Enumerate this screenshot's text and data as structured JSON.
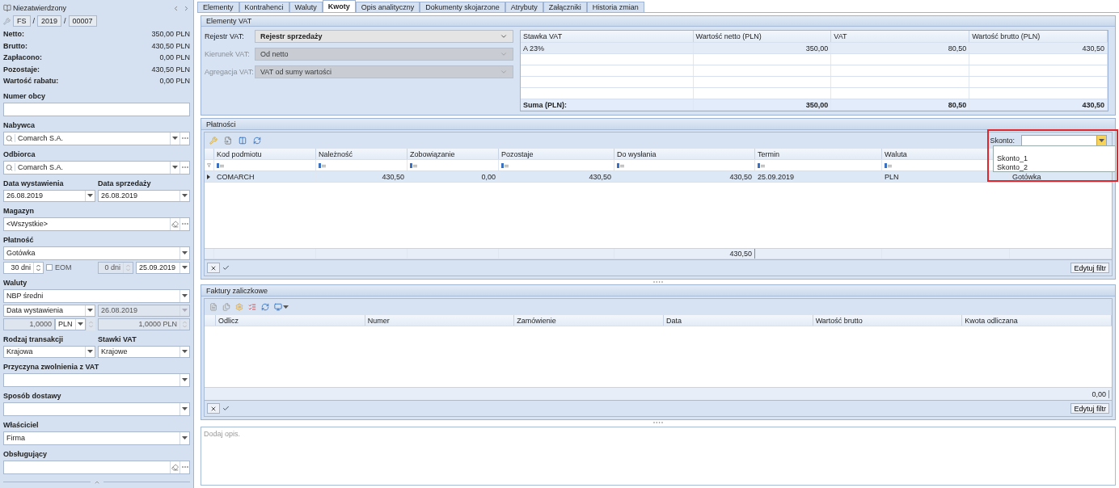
{
  "sidebar": {
    "status": "Niezatwierdzony",
    "document_number": [
      {
        "kind": "part",
        "text": "FS"
      },
      {
        "kind": "separator",
        "text": "/"
      },
      {
        "kind": "part",
        "text": "2019"
      },
      {
        "kind": "separator",
        "text": "/"
      },
      {
        "kind": "part",
        "text": "00007"
      }
    ],
    "summary": [
      {
        "label": "Netto:",
        "value": "350,00 PLN"
      },
      {
        "label": "Brutto:",
        "value": "430,50 PLN"
      },
      {
        "label": "Zapłacono:",
        "value": "0,00 PLN"
      },
      {
        "label": "Pozostaje:",
        "value": "430,50 PLN"
      },
      {
        "label": "Wartość rabatu:",
        "value": "0,00 PLN"
      }
    ],
    "fields": [
      {
        "kind": "text",
        "label": "Numer obcy"
      },
      {
        "kind": "lookup",
        "label": "Nabywca",
        "value": "Comarch S.A."
      },
      {
        "kind": "lookup",
        "label": "Odbiorca",
        "value": "Comarch S.A."
      },
      {
        "kind": "pair",
        "items": [
          {
            "label": "Data wystawienia",
            "value": "26.08.2019"
          },
          {
            "label": "Data sprzedaży",
            "value": "26.08.2019"
          }
        ]
      },
      {
        "kind": "clearable",
        "label": "Magazyn",
        "value": "<Wszystkie>"
      },
      {
        "kind": "select",
        "label": "Płatność",
        "value": "Gotówka"
      },
      {
        "kind": "terms",
        "days": "30 dni",
        "eom_label": "EOM",
        "eom_checked": false,
        "extra_days": {
          "value": "0 dni",
          "disabled": true
        },
        "due_date": "25.09.2019"
      },
      {
        "kind": "select",
        "label": "Waluty",
        "value": "NBP średni"
      },
      {
        "kind": "rate_date",
        "basis": "Data wystawienia",
        "date": {
          "value": "26.08.2019",
          "disabled": true
        }
      },
      {
        "kind": "rate",
        "rate": {
          "value": "1,0000",
          "disabled": true
        },
        "currency": "PLN",
        "converted": {
          "value": "1,0000 PLN",
          "disabled": true
        }
      },
      {
        "kind": "pair",
        "items": [
          {
            "label": "Rodzaj transakcji",
            "value": "Krajowa"
          },
          {
            "label": "Stawki VAT",
            "value": "Krajowe"
          }
        ]
      },
      {
        "kind": "select",
        "label": "Przyczyna zwolnienia z VAT"
      },
      {
        "kind": "select",
        "label": "Sposób dostawy"
      },
      {
        "kind": "select",
        "label": "Właściciel",
        "value": "Firma"
      },
      {
        "kind": "clearable",
        "label": "Obsługujący"
      }
    ]
  },
  "tabs": [
    {
      "label": "Elementy",
      "selected": false
    },
    {
      "label": "Kontrahenci",
      "selected": false
    },
    {
      "label": "Waluty",
      "selected": false
    },
    {
      "label": "Kwoty",
      "selected": true
    },
    {
      "label": "Opis analityczny",
      "selected": false
    },
    {
      "label": "Dokumenty skojarzone",
      "selected": false
    },
    {
      "label": "Atrybuty",
      "selected": false
    },
    {
      "label": "Załączniki",
      "selected": false
    },
    {
      "label": "Historia zmian",
      "selected": false
    }
  ],
  "vat": {
    "title": "Elementy VAT",
    "fields": [
      {
        "label": "Rejestr VAT:",
        "value": "Rejestr sprzedaży",
        "disabled": false
      },
      {
        "label": "Kierunek VAT:",
        "value": "Od netto",
        "disabled": true
      },
      {
        "label": "Agregacja VAT:",
        "value": "VAT od sumy wartości",
        "disabled": true
      }
    ],
    "table": {
      "columns": [
        "Stawka VAT",
        "Wartość netto (PLN)",
        "VAT",
        "Wartość brutto (PLN)"
      ],
      "rows": [
        [
          "A 23%",
          "350,00",
          "80,50",
          "430,50"
        ]
      ],
      "totals": [
        "Suma (PLN):",
        "350,00",
        "80,50",
        "430,50"
      ]
    }
  },
  "payments": {
    "title": "Płatności",
    "skonto": {
      "label": "Skonto:",
      "expanded": true,
      "options": [
        "Skonto_1",
        "Skonto_2"
      ]
    },
    "columns": [
      "Kod podmiotu",
      "Należność",
      "Zobowiązanie",
      "Pozostaje",
      "Do wysłania",
      "Termin",
      "Waluta"
    ],
    "rows": [
      {
        "selected": true,
        "cells": [
          "COMARCH",
          "430,50",
          "0,00",
          "430,50",
          "430,50",
          "25.09.2019",
          "PLN",
          "Gotówka"
        ]
      }
    ],
    "footer_total": "430,50",
    "filter_button": "Edytuj filtr"
  },
  "advance_invoices": {
    "title": "Faktury zaliczkowe",
    "columns": [
      "Odlicz",
      "Numer",
      "Zamówienie",
      "Data",
      "Wartość brutto",
      "Kwota odliczana"
    ],
    "footer_total": "0,00",
    "filter_button": "Edytuj filtr"
  },
  "description": {
    "placeholder": "Dodaj opis."
  }
}
